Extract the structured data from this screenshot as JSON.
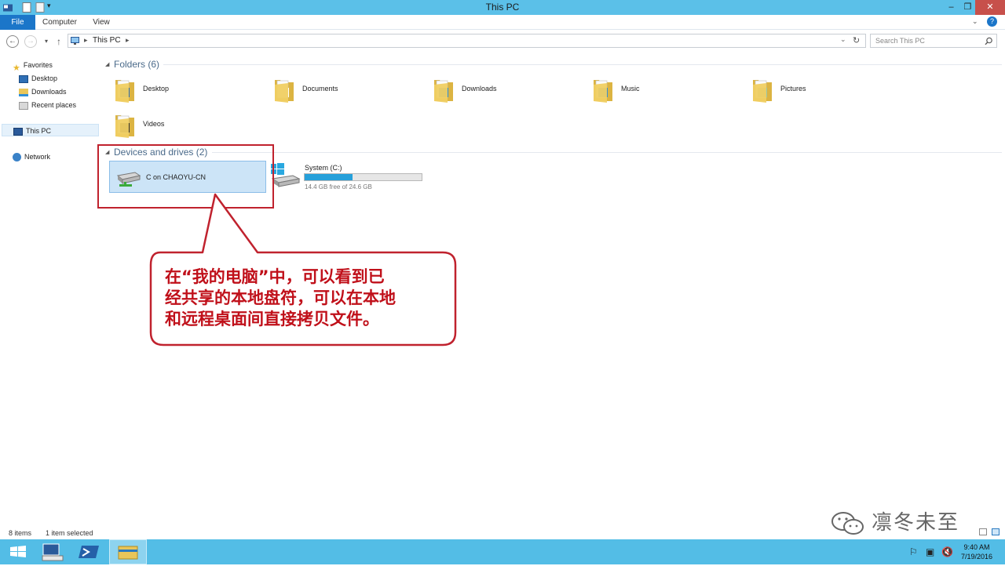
{
  "window": {
    "title": "This PC"
  },
  "title_buttons": {
    "minimize": "‒",
    "maximize": "❐",
    "close": "✕"
  },
  "ribbon": {
    "tabs": [
      "File",
      "Computer",
      "View"
    ]
  },
  "address": {
    "path": "This PC",
    "separator": "▸"
  },
  "search": {
    "placeholder": "Search This PC"
  },
  "nav_pane": {
    "favorites": {
      "label": "Favorites",
      "items": [
        "Desktop",
        "Downloads",
        "Recent places"
      ]
    },
    "this_pc": "This PC",
    "network": "Network"
  },
  "folders": {
    "header": "Folders (6)",
    "items": [
      {
        "label": "Desktop",
        "icon": "folder-desktop-icon"
      },
      {
        "label": "Documents",
        "icon": "folder-documents-icon"
      },
      {
        "label": "Downloads",
        "icon": "folder-downloads-icon"
      },
      {
        "label": "Music",
        "icon": "folder-music-icon"
      },
      {
        "label": "Pictures",
        "icon": "folder-pictures-icon"
      },
      {
        "label": "Videos",
        "icon": "folder-videos-icon"
      }
    ]
  },
  "drives": {
    "header": "Devices and drives (2)",
    "items": [
      {
        "label": "C on CHAOYU-CN",
        "icon": "network-drive-icon",
        "selected": true
      },
      {
        "label": "System (C:)",
        "icon": "system-drive-icon",
        "free_text": "14.4 GB free of 24.6 GB",
        "used_fraction": 0.41
      }
    ]
  },
  "annotation": {
    "lines": [
      "在“我的电脑”中，可以看到已",
      "经共享的本地盘符，可以在本地",
      "和远程桌面间直接拷贝文件。"
    ],
    "color": "#c0101a"
  },
  "status": {
    "item_count": "8 items",
    "selected": "1 item selected"
  },
  "taskbar": {
    "time": "9:40 AM",
    "date": "7/19/2016"
  },
  "watermark": "凛冬未至",
  "colors": {
    "titlebar": "#5bc0e8",
    "file_tab": "#1b76c9",
    "selection": "#cce4f7",
    "progress": "#26a0da",
    "taskbar": "#53bde6"
  }
}
